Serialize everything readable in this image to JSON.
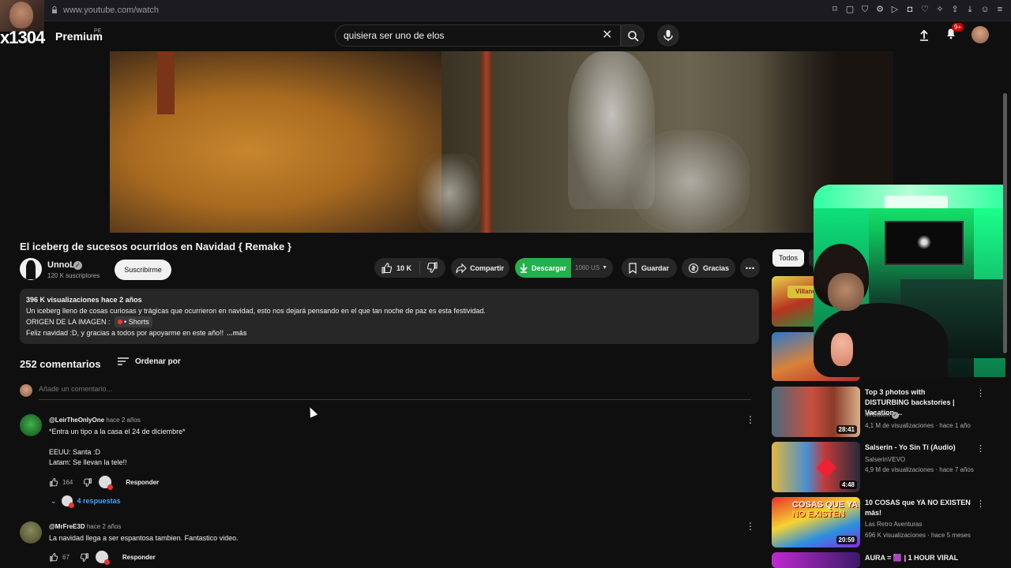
{
  "browser": {
    "url": "www.youtube.com/watch"
  },
  "header": {
    "logo_text": "x1304",
    "premium_label": "Premium",
    "premium_region": "PE",
    "search_value": "quisiera ser uno de elos",
    "notification_count": "9+"
  },
  "video": {
    "title": "El iceberg de sucesos ocurridos en Navidad { Remake }",
    "channel_name": "UnnoL",
    "subscribers": "120 K suscriptores",
    "subscribe_label": "Suscribirme",
    "likes": "10 K",
    "share_label": "Compartir",
    "download_label": "Descargar",
    "download_quality": "1080 US",
    "save_label": "Guardar",
    "thanks_label": "Gracias"
  },
  "description": {
    "meta": "396 K visualizaciones  hace 2 años",
    "line1": "Un iceberg lleno de cosas curiosas y trágicas que ocurrieron en navidad, esto nos dejará pensando en el que tan noche de paz es esta festividad.",
    "line2_prefix": "ORIGEN DE LA IMAGEN :",
    "line2_badge": "• Shorts",
    "line3": "Feliz navidad :D, y gracias a todos por apoyarme en este año!!",
    "more": "...más"
  },
  "comments": {
    "count_label": "252 comentarios",
    "sort_label": "Ordenar por",
    "add_placeholder": "Añade un comentario...",
    "items": [
      {
        "user": "@LeirTheOnlyOne",
        "time": "hace 2 años",
        "lines": [
          "*Entra un tipo a la casa el 24 de diciembre*",
          "",
          "EEUU: Santa :D",
          "Latam: Se llevan la tele!!"
        ],
        "likes": "164",
        "reply_label": "Responder",
        "replies_label": "4 respuestas"
      },
      {
        "user": "@MrFreE3D",
        "time": "hace 2 años",
        "lines": [
          "La navidad llega a ser espantosa tambien. Fantastico video."
        ],
        "likes": "67",
        "reply_label": "Responder"
      }
    ]
  },
  "sidebar": {
    "chip_all": "Todos",
    "thumb1_label": "Villancicos",
    "items": [
      {
        "title": "Top 3 photos with DISTURBING backstories | Vacation ...",
        "channel": "MrBallen",
        "meta": "4,1 M de visualizaciones · hace 1 año",
        "duration": "28:41"
      },
      {
        "title": "Salserin - Yo Sin Tí (Audio)",
        "channel": "SalserinVEVO",
        "meta": "4,9 M de visualizaciones · hace 7 años",
        "duration": "4:48"
      },
      {
        "title": "10 COSAS que YA NO EXISTEN más!",
        "channel": "Las Retro Aventuras",
        "meta": "696 K visualizaciones · hace 5 meses",
        "duration": "20:59",
        "thumb_text_1": "COSAS QUE YA",
        "thumb_text_2": "NO EXISTEN"
      },
      {
        "title": "AURA = 🟪 | 1 HOUR VIRAL"
      }
    ]
  }
}
